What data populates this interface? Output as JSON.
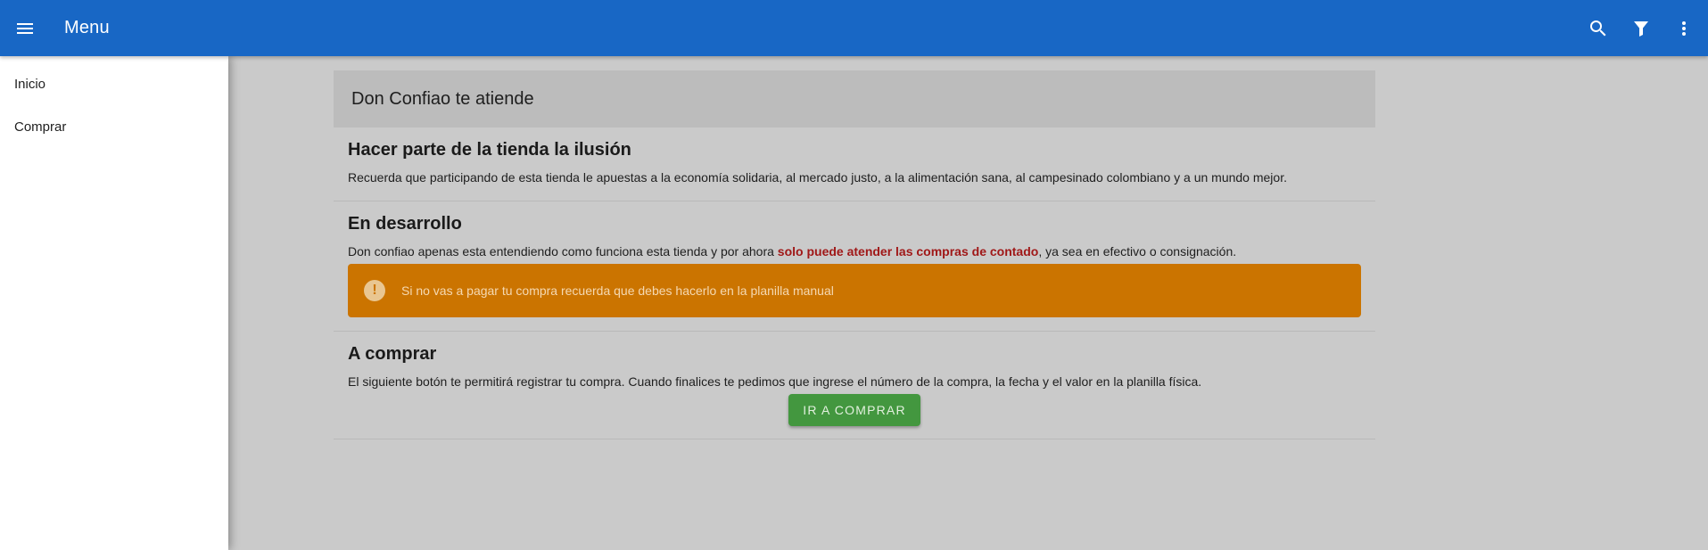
{
  "appbar": {
    "title": "Menu",
    "menu_icon": "hamburger-menu-icon",
    "search_icon": "search-icon",
    "filter_icon": "filter-icon",
    "more_icon": "more-vertical-icon",
    "color": "#1867c5"
  },
  "drawer": {
    "items": [
      {
        "label": "Inicio"
      },
      {
        "label": "Comprar"
      }
    ]
  },
  "main": {
    "header": "Don Confiao te atiende",
    "sections": [
      {
        "title": "Hacer parte de la tienda la ilusión",
        "text": "Recuerda que participando de esta tienda le apuestas a la economía solidaria, al mercado justo, a la alimentación sana, al campesinado colombiano y a un mundo mejor."
      },
      {
        "title": "En desarrollo",
        "text_before": "Don confiao apenas esta entendiendo como funciona esta tienda y por ahora ",
        "text_highlight": "solo puede atender las compras de contado",
        "text_after": ", ya sea en efectivo o consignación.",
        "alert": {
          "icon": "exclamation-circle-icon",
          "text": "Si no vas a pagar tu compra recuerda que debes hacerlo en la planilla manual",
          "color": "#cb7400"
        }
      },
      {
        "title": "A comprar",
        "text": "El siguiente botón te permitirá registrar tu compra. Cuando finalices te pedimos que ingrese el número de la compra, la fecha y el valor en la planilla física.",
        "button_label": "Ir a comprar",
        "button_color": "#43973f"
      }
    ]
  }
}
